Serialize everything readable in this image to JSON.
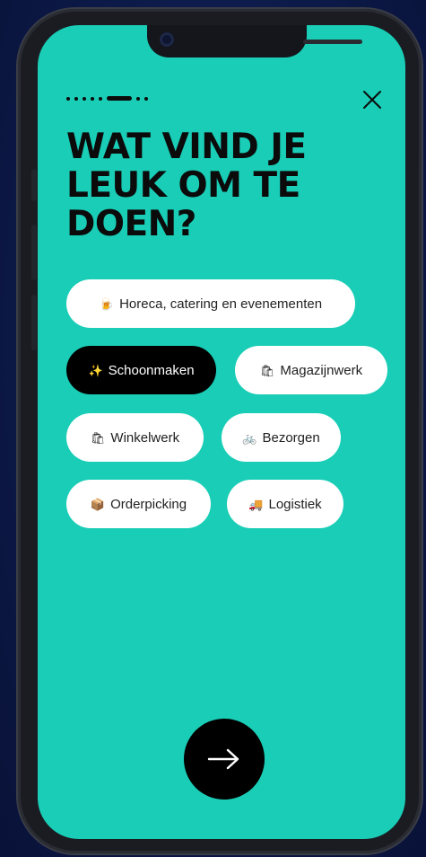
{
  "onboarding": {
    "progress": {
      "total_steps": 8,
      "current_step": 6
    },
    "title": "WAT VIND JE\nLEUK OM TE\nDOEN?",
    "options": [
      {
        "label": "Horeca, catering en evenementen",
        "icon": "beer-mug-icon",
        "icon_glyph": "🍺",
        "selected": false
      },
      {
        "label": "Schoonmaken",
        "icon": "sparkles-icon",
        "icon_glyph": "✨",
        "selected": true
      },
      {
        "label": "Magazijnwerk",
        "icon": "shopping-bags-icon",
        "icon_glyph": "🛍",
        "selected": false
      },
      {
        "label": "Winkelwerk",
        "icon": "shopping-bags-icon",
        "icon_glyph": "🛍",
        "selected": false
      },
      {
        "label": "Bezorgen",
        "icon": "bicycle-icon",
        "icon_glyph": "🚲",
        "selected": false
      },
      {
        "label": "Orderpicking",
        "icon": "package-icon",
        "icon_glyph": "📦",
        "selected": false
      },
      {
        "label": "Logistiek",
        "icon": "truck-icon",
        "icon_glyph": "🚚",
        "selected": false
      }
    ],
    "close_icon": "close-icon",
    "next_icon": "arrow-right-icon"
  },
  "colors": {
    "screen_background": "#19cdb6",
    "chip_background": "#ffffff",
    "chip_selected_background": "#000000",
    "text_dark": "#0b0b0b",
    "backdrop": "#0c1a48"
  }
}
